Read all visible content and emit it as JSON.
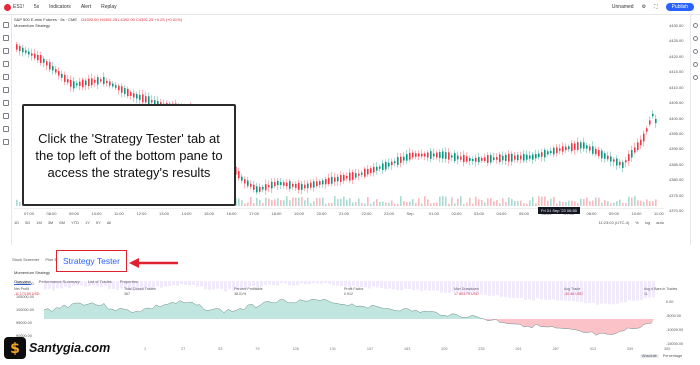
{
  "toolbar": {
    "symbol": "ES1!",
    "interval": "5s",
    "indicators": "Indicators",
    "alert": "Alert",
    "replay": "Replay",
    "unnamed": "Unnamed",
    "publish": "Publish"
  },
  "legend": {
    "title": "S&P 500 E-mini Futures · 5s · CME",
    "ohlc": "O4392.00 H4392.25 L4392.00 C4392.25 +0.25 (+0.01%)",
    "study": "Momentum Strategy"
  },
  "price_axis": [
    "4430.00",
    "4425.00",
    "4420.00",
    "4415.00",
    "4410.00",
    "4405.00",
    "4400.00",
    "4395.00",
    "4390.00",
    "4385.00",
    "4380.00",
    "4375.00",
    "4370.00"
  ],
  "time_axis": [
    "07:00",
    "08:00",
    "09:00",
    "10:00",
    "11:00",
    "12:00",
    "13:00",
    "14:00",
    "15:00",
    "16:00",
    "17:00",
    "18:00",
    "19:00",
    "20:00",
    "21:00",
    "22:00",
    "23:00",
    "Sep",
    "01:00",
    "02:00",
    "03:00",
    "04:00",
    "05:00",
    "06:00",
    "07:00",
    "08:00",
    "09:00",
    "10:00",
    "11:00"
  ],
  "cursor_date": "Fri 01 Sep '23 06:55",
  "range_bar": {
    "ranges": [
      "1D",
      "5D",
      "1M",
      "3M",
      "6M",
      "YTD",
      "1Y",
      "5Y",
      "All"
    ],
    "utc": "11:23:03 (UTC-4)",
    "pct": "%",
    "log": "log",
    "auto": "auto"
  },
  "callout": {
    "text": "Click the 'Strategy Tester' tab at the top left of the bottom pane to access the strategy's results"
  },
  "bottom_tabs": {
    "stock_screener": "Stock Screener",
    "pine": "Pine Editor",
    "strategy_tester": "Strategy Tester"
  },
  "strategy": {
    "title": "Momentum Strategy",
    "subtabs": [
      "Overview",
      "Performance Summary",
      "List of Trades",
      "Properties"
    ]
  },
  "metrics": [
    {
      "label": "Net Profit",
      "value": "-11 173.50 USD",
      "tone": "red"
    },
    {
      "label": "Total Closed Trades",
      "value": "367",
      "tone": ""
    },
    {
      "label": "Percent Profitable",
      "value": "38.01%",
      "tone": ""
    },
    {
      "label": "Profit Factor",
      "value": "0.912",
      "tone": ""
    },
    {
      "label": "Max Drawdown",
      "value": "17 803.75 USD",
      "tone": "red"
    },
    {
      "label": "Avg Trade",
      "value": "-30.46 USD",
      "tone": "red"
    },
    {
      "label": "Avg # Bars in Trades",
      "value": "11",
      "tone": ""
    }
  ],
  "equity_left_axis": [
    "110000.00",
    "105000.00",
    "100000.00",
    "95000.00",
    "90000.00"
  ],
  "equity_right_axis": [
    "0.00",
    "-5000.00",
    "-10000.00",
    "-15000.00"
  ],
  "equity_x_axis": [
    "1",
    "27",
    "53",
    "79",
    "105",
    "131",
    "157",
    "183",
    "209",
    "235",
    "261",
    "287",
    "313",
    "339",
    "365"
  ],
  "equity_toggle": {
    "absolute": "Absolute",
    "percentage": "Percentage"
  },
  "brand": {
    "name": "Santygia.com"
  },
  "colors": {
    "up": "#089981",
    "down": "#f23645",
    "accent": "#2962ff",
    "highlight_border": "#e0212f"
  }
}
